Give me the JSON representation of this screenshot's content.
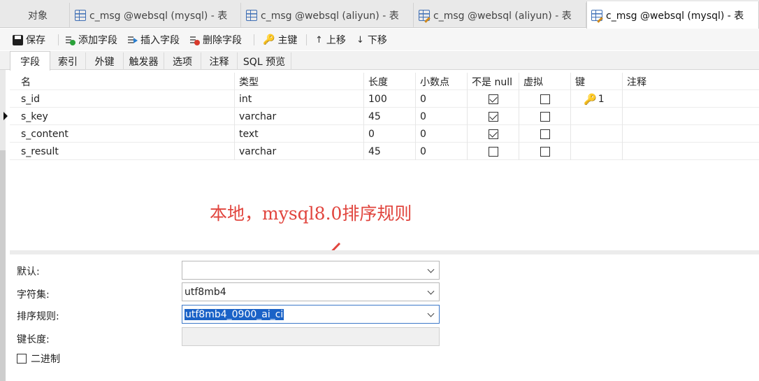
{
  "tabs": [
    {
      "label": "对象",
      "active": false,
      "icon": "none"
    },
    {
      "label": "c_msg @websql (mysql) - 表",
      "active": false,
      "icon": "table-icon"
    },
    {
      "label": "c_msg @websql (aliyun) - 表",
      "active": false,
      "icon": "table-icon"
    },
    {
      "label": "c_msg @websql (aliyun) - 表",
      "active": false,
      "icon": "edit-table-icon"
    },
    {
      "label": "c_msg @websql (mysql) - 表",
      "active": true,
      "icon": "edit-table-icon"
    }
  ],
  "toolbar": {
    "save": "保存",
    "add_field": "添加字段",
    "insert_field": "插入字段",
    "delete_field": "删除字段",
    "primary_key": "主键",
    "move_up": "上移",
    "move_down": "下移"
  },
  "subtabs": [
    {
      "label": "字段",
      "active": true
    },
    {
      "label": "索引",
      "active": false
    },
    {
      "label": "外键",
      "active": false
    },
    {
      "label": "触发器",
      "active": false
    },
    {
      "label": "选项",
      "active": false
    },
    {
      "label": "注释",
      "active": false
    },
    {
      "label": "SQL 预览",
      "active": false
    }
  ],
  "grid": {
    "columns": {
      "name": "名",
      "type": "类型",
      "length": "长度",
      "decimals": "小数点",
      "not_null": "不是 null",
      "virtual": "虚拟",
      "key": "键",
      "comment": "注释"
    },
    "rows": [
      {
        "name": "s_id",
        "type": "int",
        "length": "100",
        "decimals": "0",
        "not_null": true,
        "virtual": false,
        "key": "1",
        "comment": "",
        "current": false
      },
      {
        "name": "s_key",
        "type": "varchar",
        "length": "45",
        "decimals": "0",
        "not_null": true,
        "virtual": false,
        "key": "",
        "comment": "",
        "current": true
      },
      {
        "name": "s_content",
        "type": "text",
        "length": "0",
        "decimals": "0",
        "not_null": true,
        "virtual": false,
        "key": "",
        "comment": "",
        "current": false
      },
      {
        "name": "s_result",
        "type": "varchar",
        "length": "45",
        "decimals": "0",
        "not_null": false,
        "virtual": false,
        "key": "",
        "comment": "",
        "current": false
      }
    ]
  },
  "annotation": {
    "text": "本地，mysql8.0排序规则",
    "color": "#e1453e"
  },
  "props": {
    "default_label": "默认:",
    "default_value": "",
    "charset_label": "字符集:",
    "charset_value": "utf8mb4",
    "collation_label": "排序规则:",
    "collation_value": "utf8mb4_0900_ai_ci",
    "key_length_label": "键长度:",
    "key_length_value": "",
    "binary_label": "二进制",
    "binary_checked": false
  },
  "colors": {
    "accent": "#1a62c7",
    "key_icon": "#d7a01e"
  }
}
